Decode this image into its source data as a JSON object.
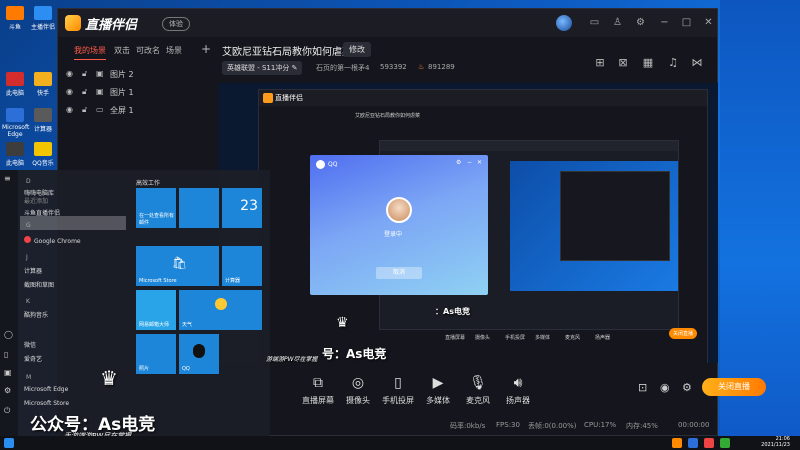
{
  "app": {
    "title": "直播伴侣",
    "experience_badge": "体验",
    "scene_tabs": [
      "我的场景",
      "双击",
      "可改名",
      "场景"
    ],
    "sources": [
      {
        "label": "图片 2"
      },
      {
        "label": "图片 1"
      },
      {
        "label": "全屏 1"
      }
    ],
    "stream_title": "艾欧尼亚钻石局教你如何虐菜",
    "edit_label": "修改",
    "category": "英雄联盟 - S11冲分",
    "channel": "石页的第一根矛4",
    "room_id": "593392",
    "popularity": "891289"
  },
  "startmenu": {
    "letters": [
      "D",
      "G",
      "J",
      "K",
      "M"
    ],
    "items": [
      "嗨嗨电脑库",
      "最近添加",
      "斗鱼直播伴侣",
      "Google Chrome",
      "计算器",
      "截图和草图",
      "酷狗音乐",
      "微信",
      "爱奇艺",
      "Microsoft Edge",
      "Microsoft Store"
    ],
    "group_label": "高效工作",
    "tiles": {
      "office": "在一处查看所有邮件",
      "calendar_day": "23",
      "store": "Microsoft Store",
      "calc": "计算器",
      "browser": "网易邮箱大师",
      "weather": "天气",
      "photos": "照片",
      "qq": "QQ"
    }
  },
  "qq_login": {
    "title": "QQ",
    "status": "登录中",
    "cancel": "取消"
  },
  "toolbar": {
    "tools": [
      {
        "label": "直播屏幕",
        "icon": "screen-icon"
      },
      {
        "label": "摄像头",
        "icon": "camera-icon"
      },
      {
        "label": "手机投屏",
        "icon": "phone-cast-icon"
      },
      {
        "label": "多媒体",
        "icon": "media-icon"
      },
      {
        "label": "麦克风",
        "icon": "mic-icon"
      },
      {
        "label": "扬声器",
        "icon": "speaker-icon"
      }
    ],
    "live_button": "关闭直播"
  },
  "status_bar": {
    "bitrate": "码率:0kb/s",
    "fps": "FPS:30",
    "loss": "丢帧:0(0.00%)",
    "cpu": "CPU:17%",
    "mem": "内存:45%",
    "timer": "00:00:00"
  },
  "watermark": {
    "main": "公众号：As电竞",
    "sub": "手游端游PW尽在掌握",
    "preview_main": "号：As电竞",
    "preview_sub": "游端游PW尽在掌握",
    "nested_main": "：As电竞"
  },
  "taskbar": {
    "time": "21:06",
    "date": "2021/11/23"
  },
  "desktop": {
    "icons": [
      "斗鱼",
      "主播伴侣",
      "此电脑",
      "快手",
      "Microsoft Edge",
      "计算器",
      "此电脑",
      "QQ音乐"
    ]
  },
  "colors": {
    "accent_red": "#ff5b4a",
    "live_orange": "#ff8a00",
    "desktop_blue": "#0d5cc4"
  }
}
